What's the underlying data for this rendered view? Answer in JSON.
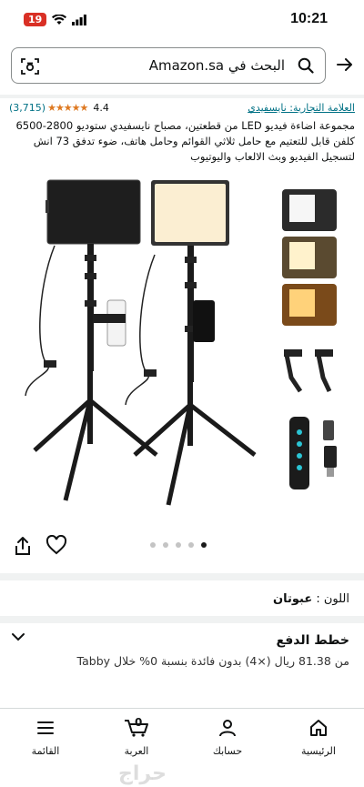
{
  "status_bar": {
    "badge": "19",
    "time": "10:21"
  },
  "search": {
    "text": "البحث في Amazon.sa"
  },
  "product": {
    "brand": "العلامة التجارية: نايسفيدي",
    "rating_value": "4.4",
    "rating_count": "(3,715)",
    "stars": "★★★★★",
    "title": "مجموعة اضاءة فيديو LED من قطعتين، مصباح نايسفيدي ستوديو 2800-6500 كلفن قابل للتعتيم مع حامل ثلاثي القوائم وحامل هاتف، ضوء تدفق 73 انش لتسجيل الفيديو وبث الالعاب واليوتيوب",
    "image_count": 5,
    "active_image": 4
  },
  "color": {
    "label": "اللون :",
    "value": "عبوتان"
  },
  "payment": {
    "title": "خطط الدفع",
    "description": "من 81.38 ريال (×4) بدون فائدة بنسبة 0% خلال Tabby"
  },
  "bottom_nav": {
    "home": "الرئيسية",
    "account": "حسابك",
    "cart": "العربة",
    "cart_count": "0",
    "menu": "القائمة"
  },
  "watermark": "حراج"
}
